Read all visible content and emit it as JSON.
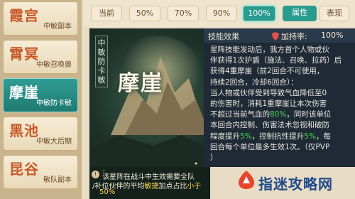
{
  "sidebar": {
    "items": [
      {
        "title": "霞宫",
        "sub": "中敏副本",
        "active": false
      },
      {
        "title": "霄冥",
        "sub": "中敏召唤兽",
        "active": false
      },
      {
        "title": "摩崖",
        "sub": "中敏防卡敏",
        "active": true
      },
      {
        "title": "黑池",
        "sub": "中敏大后期",
        "active": false
      },
      {
        "title": "昆谷",
        "sub": "敏队副本",
        "active": false
      }
    ]
  },
  "topbar": {
    "levels": [
      "当前",
      "50%",
      "70%",
      "90%",
      "100%"
    ],
    "active_level": "100%",
    "tabs": [
      "属性",
      "表现"
    ],
    "active_tab": "属性"
  },
  "main": {
    "vertical_label": "中敏防卡敏",
    "name": "摩崖"
  },
  "desc": {
    "header": "技能效果",
    "rate_label": "加持率:",
    "rate_value": "100%",
    "lines": [
      [
        {
          "t": "星阵技能发动后，我方首个人物或伙"
        }
      ],
      [
        {
          "t": "伴获得1次护盾（施法、召唤、拉药）后"
        }
      ],
      [
        {
          "t": "获得4重摩崖（前2回合不可使用，"
        }
      ],
      [
        {
          "t": "持续2回合，冷却6回合）："
        }
      ],
      [
        {
          "t": "当人物或伙伴受到导致气血降低至0"
        }
      ],
      [
        {
          "t": "的伤害时，消耗1重摩崖让本次伤害"
        }
      ],
      [
        {
          "t": "不超过当前气血的"
        },
        {
          "t": "80%",
          "g": true
        },
        {
          "t": "，同时该单位"
        }
      ],
      [
        {
          "t": "本回合内控制、伤害法术忽视和破防"
        }
      ],
      [
        {
          "t": "程度提升"
        },
        {
          "t": "5%",
          "g": true
        },
        {
          "t": "，控制抗性提升"
        },
        {
          "t": "5%",
          "g": true
        },
        {
          "t": "，每"
        }
      ],
      [
        {
          "t": "回合每个单位最多生效1次。（仅PVP"
        }
      ],
      [
        {
          "t": "）"
        }
      ]
    ]
  },
  "note": {
    "icon": "!",
    "line1": "该星阵在战斗中生效需要全队",
    "line2a": "/补位伙伴的平均",
    "line2b": "敏捷",
    "line2c": "加点占比",
    "line2d": "小于",
    "line3": "50%"
  },
  "watermark": {
    "text": "指迷攻略网"
  },
  "colors": {
    "accent": "#2a9c8f",
    "title_red": "#c85a2a",
    "green": "#48d24c",
    "yellow": "#ffd34a"
  }
}
